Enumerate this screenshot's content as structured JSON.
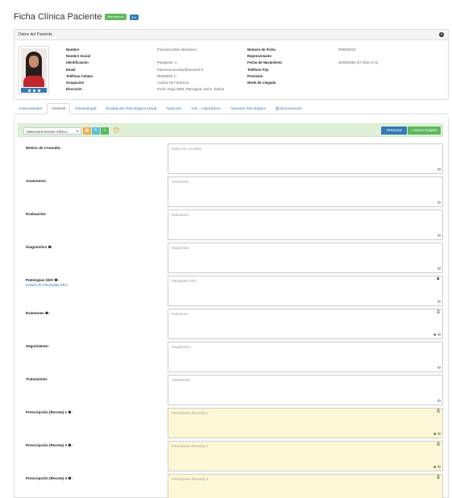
{
  "header": {
    "title": "Ficha Clínica Paciente",
    "status_badge": "Atendiendo",
    "menu_badge": "$ ▾"
  },
  "patient_panel": {
    "title": "Datos del Paciente",
    "col1_labels": [
      "Nombre",
      "Nombre Social",
      "Identificación",
      "Email",
      "Teléfono Celular",
      "Ocupación",
      "Dirección"
    ],
    "col2_values": [
      "Francisca Brito Mardones",
      "",
      "Pasaporte: 1",
      "francisca.escobar@sacmed.cl",
      "95400920",
      "Auxiliar de Farmacia",
      "Pedro Vega 4056, Rancagua, Aisén, Ñuñoa"
    ],
    "col3_labels": [
      "Número de Ficha",
      "Representante",
      "Fecha de Nacimiento",
      "Teléfono Fijo",
      "Previsión",
      "Modo de Llegada"
    ],
    "col4_values": [
      "000000010",
      "",
      "25/08/1993 (27 años 9 m)",
      "",
      "",
      ""
    ]
  },
  "tabs": [
    "Antecedentes",
    "General",
    "Kinesiología",
    "Evaluación Psicológica Inicial",
    "Nutrición",
    "VIH - Laboratorio",
    "Atención Psicológica",
    "Documentos"
  ],
  "active_tab": "General",
  "toolbar": {
    "select_value": "Seleccione Evento Clínico...",
    "history_button": "Historial",
    "new_record_button": "Nuevo Registro"
  },
  "fields": [
    {
      "label": "Motivo de Consulta:",
      "placeholder": "Motivo de Consulta",
      "yellow": false
    },
    {
      "label": "Anamnesis:",
      "placeholder": "Anamnesis",
      "yellow": false
    },
    {
      "label": "Evaluación:",
      "placeholder": "Evaluación",
      "yellow": false
    },
    {
      "label": "Diagnóstico ❶:",
      "placeholder": "Diagnóstico",
      "yellow": false
    },
    {
      "label": "Patologías GES ❶:",
      "sublink": "Listado de Patologías GES",
      "placeholder": "Patologías GES",
      "yellow": false
    },
    {
      "label": "Exámenes ❶:",
      "placeholder": "Exámenes",
      "yellow": false
    },
    {
      "label": "Seguimiento:",
      "placeholder": "Seguimiento",
      "yellow": false
    },
    {
      "label": "Tratamiento:",
      "placeholder": "Tratamiento",
      "yellow": false
    },
    {
      "label": "Prescripción (Receta) 1 ❶:",
      "placeholder": "Prescripción (Receta) 1",
      "yellow": true
    },
    {
      "label": "Prescripción (Receta) 2 ❶:",
      "placeholder": "Prescripción (Receta) 2",
      "yellow": true
    },
    {
      "label": "Prescripción (Receta) 3 ❶:",
      "placeholder": "Prescripción (Receta) 3",
      "yellow": true
    }
  ]
}
